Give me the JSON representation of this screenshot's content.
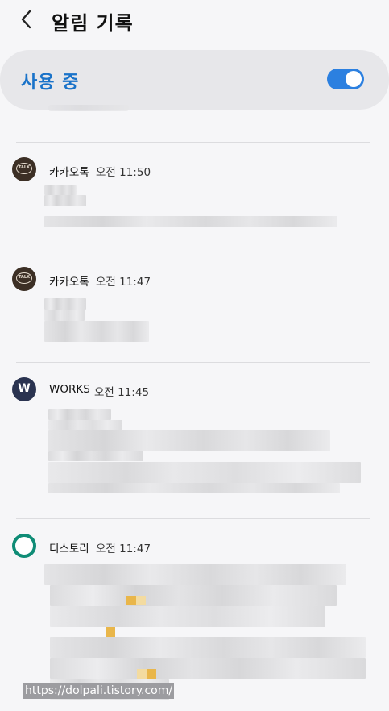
{
  "header": {
    "back_icon": "chevron-left-icon",
    "title": "알림 기록"
  },
  "master_toggle": {
    "label": "사용 중",
    "enabled": true,
    "accent_color": "#1a73c9",
    "switch_color": "#2c80e0"
  },
  "notifications": [
    {
      "app": "카카오톡",
      "time": "오전 11:50",
      "icon": "kakaotalk-icon",
      "icon_text": "TALK"
    },
    {
      "app": "카카오톡",
      "time": "오전 11:47",
      "icon": "kakaotalk-icon",
      "icon_text": "TALK"
    },
    {
      "app": "WORKS",
      "time": "오전 11:45",
      "icon": "works-icon",
      "icon_text": "W"
    },
    {
      "app": "티스토리",
      "time": "오전 11:47",
      "icon": "tistory-icon"
    }
  ],
  "watermark": "https://dolpali.tistory.com/"
}
